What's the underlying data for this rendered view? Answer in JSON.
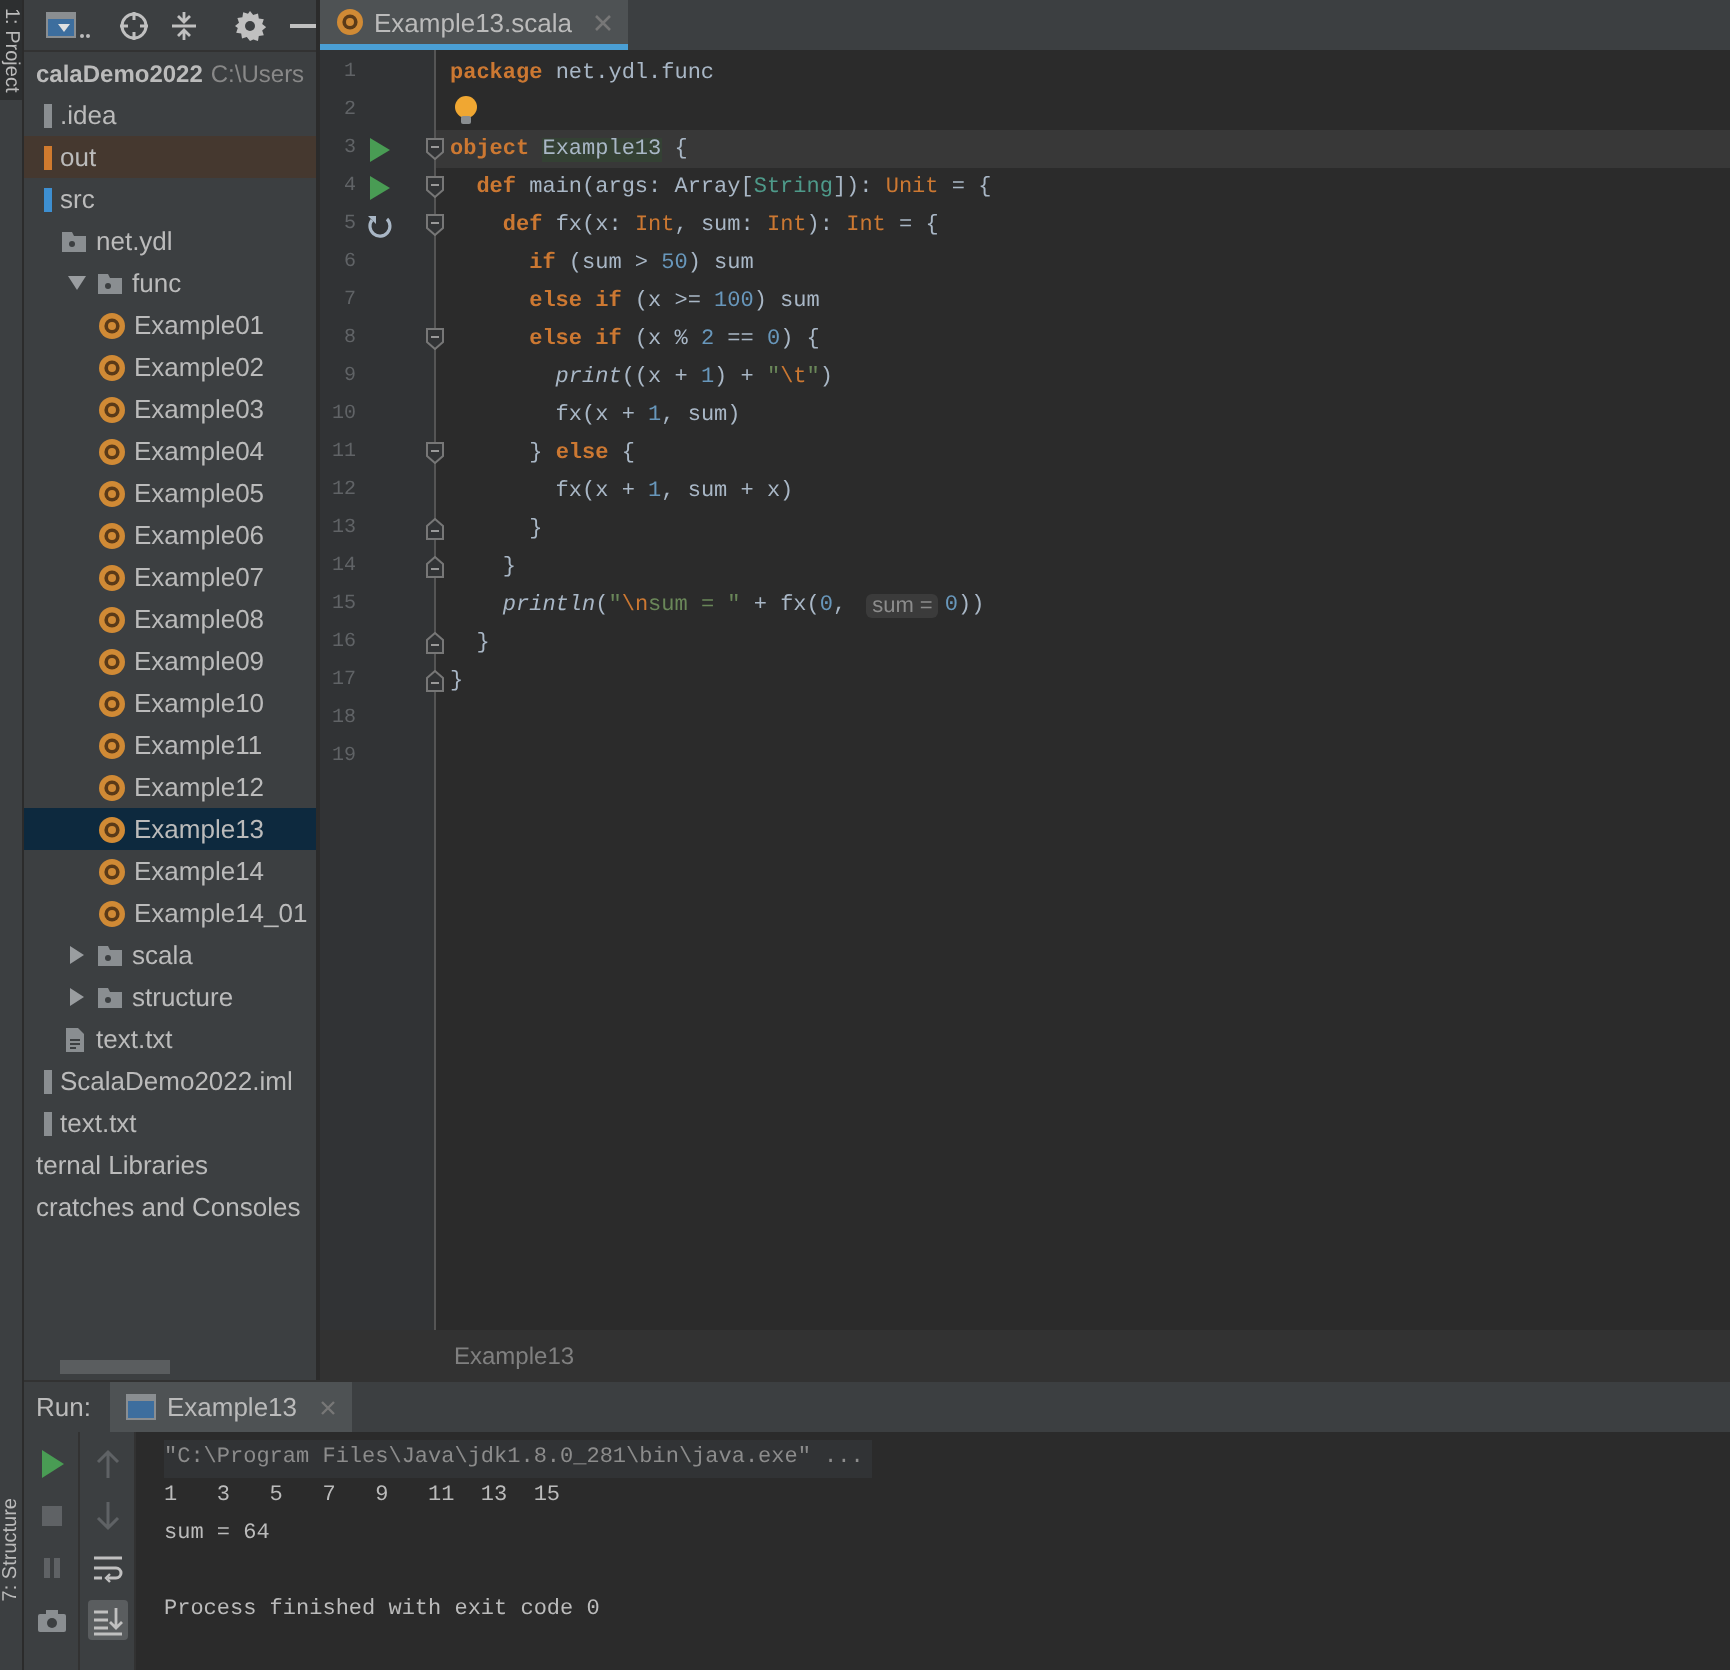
{
  "side_tabs": [
    {
      "label": "1: Project",
      "selected": true
    },
    {
      "label": "7: Structure",
      "selected": false
    }
  ],
  "project_tree": [
    {
      "label": "calaDemo2022",
      "path": "C:\\Users",
      "kind": "project",
      "selected": false,
      "children": [
        {
          "label": ".idea",
          "kind": "folder",
          "selected": false
        },
        {
          "label": "out",
          "kind": "excluded",
          "selected": false
        },
        {
          "label": "src",
          "kind": "source",
          "selected": false,
          "children": [
            {
              "label": "net.ydl",
              "kind": "package",
              "selected": false
            },
            {
              "label": "func",
              "kind": "package",
              "selected": false,
              "expanded": true,
              "children": [
                {
                  "label": "Example01",
                  "kind": "object",
                  "selected": false
                },
                {
                  "label": "Example02",
                  "kind": "object",
                  "selected": false
                },
                {
                  "label": "Example03",
                  "kind": "object",
                  "selected": false
                },
                {
                  "label": "Example04",
                  "kind": "object",
                  "selected": false
                },
                {
                  "label": "Example05",
                  "kind": "object",
                  "selected": false
                },
                {
                  "label": "Example06",
                  "kind": "object",
                  "selected": false
                },
                {
                  "label": "Example07",
                  "kind": "object",
                  "selected": false
                },
                {
                  "label": "Example08",
                  "kind": "object",
                  "selected": false
                },
                {
                  "label": "Example09",
                  "kind": "object",
                  "selected": false
                },
                {
                  "label": "Example10",
                  "kind": "object",
                  "selected": false
                },
                {
                  "label": "Example11",
                  "kind": "object",
                  "selected": false
                },
                {
                  "label": "Example12",
                  "kind": "object",
                  "selected": false
                },
                {
                  "label": "Example13",
                  "kind": "object",
                  "selected": true
                },
                {
                  "label": "Example14",
                  "kind": "object",
                  "selected": false
                },
                {
                  "label": "Example14_01",
                  "kind": "object",
                  "selected": false
                }
              ]
            },
            {
              "label": "scala",
              "kind": "package",
              "selected": false,
              "expanded": false
            },
            {
              "label": "structure",
              "kind": "package",
              "selected": false,
              "expanded": false
            },
            {
              "label": "text.txt",
              "kind": "file",
              "selected": false
            }
          ]
        },
        {
          "label": "ScalaDemo2022.iml",
          "kind": "module",
          "selected": false
        },
        {
          "label": "text.txt",
          "kind": "file",
          "selected": false
        }
      ]
    },
    {
      "label": "ternal Libraries",
      "kind": "libraries",
      "selected": false
    },
    {
      "label": "cratches and Consoles",
      "kind": "scratches",
      "selected": false
    }
  ],
  "editor_tabs": [
    {
      "label": "Example13.scala",
      "selected": true
    }
  ],
  "code_lines": [
    {
      "number": "1",
      "current": false,
      "tokens": [
        {
          "kind": "kw",
          "text": "package"
        },
        {
          "kind": "plain",
          "text": " net.ydl.func"
        }
      ]
    },
    {
      "number": "2",
      "current": false,
      "icons": [
        {
          "kind": "bulb"
        }
      ]
    },
    {
      "number": "3",
      "current": true,
      "icons": [
        {
          "kind": "run"
        },
        {
          "kind": "fold-start"
        }
      ],
      "tokens": [
        {
          "kind": "kw",
          "text": "object "
        },
        {
          "kind": "decl",
          "text": "Example13"
        },
        {
          "kind": "plain",
          "text": " {"
        }
      ]
    },
    {
      "number": "4",
      "current": false,
      "icons": [
        {
          "kind": "run"
        },
        {
          "kind": "fold-start"
        }
      ],
      "tokens": [
        {
          "kind": "kw",
          "text": "  def"
        },
        {
          "kind": "plain",
          "text": " main(args: Array["
        },
        {
          "kind": "type",
          "text": "String"
        },
        {
          "kind": "plain",
          "text": "]): "
        },
        {
          "kind": "kwtype",
          "text": "Unit"
        },
        {
          "kind": "plain",
          "text": " = {"
        }
      ]
    },
    {
      "number": "5",
      "current": false,
      "icons": [
        {
          "kind": "recursion"
        },
        {
          "kind": "fold-start"
        }
      ],
      "tokens": [
        {
          "kind": "kw",
          "text": "    def"
        },
        {
          "kind": "plain",
          "text": " fx(x: "
        },
        {
          "kind": "kwtype",
          "text": "Int"
        },
        {
          "kind": "plain",
          "text": ", sum: "
        },
        {
          "kind": "kwtype",
          "text": "Int"
        },
        {
          "kind": "plain",
          "text": "): "
        },
        {
          "kind": "kwtype",
          "text": "Int"
        },
        {
          "kind": "plain",
          "text": " = {"
        }
      ]
    },
    {
      "number": "6",
      "current": false,
      "tokens": [
        {
          "kind": "kw",
          "text": "      if"
        },
        {
          "kind": "plain",
          "text": " (sum > "
        },
        {
          "kind": "num",
          "text": "50"
        },
        {
          "kind": "plain",
          "text": ") sum"
        }
      ]
    },
    {
      "number": "7",
      "current": false,
      "tokens": [
        {
          "kind": "kw",
          "text": "      else if"
        },
        {
          "kind": "plain",
          "text": " (x >= "
        },
        {
          "kind": "num",
          "text": "100"
        },
        {
          "kind": "plain",
          "text": ") sum"
        }
      ]
    },
    {
      "number": "8",
      "current": false,
      "icons": [
        {
          "kind": "fold-start"
        }
      ],
      "tokens": [
        {
          "kind": "kw",
          "text": "      else if"
        },
        {
          "kind": "plain",
          "text": " (x % "
        },
        {
          "kind": "num",
          "text": "2"
        },
        {
          "kind": "plain",
          "text": " == "
        },
        {
          "kind": "num",
          "text": "0"
        },
        {
          "kind": "plain",
          "text": ") {"
        }
      ]
    },
    {
      "number": "9",
      "current": false,
      "tokens": [
        {
          "kind": "call",
          "text": "        print"
        },
        {
          "kind": "plain",
          "text": "((x + "
        },
        {
          "kind": "num",
          "text": "1"
        },
        {
          "kind": "plain",
          "text": ") + "
        },
        {
          "kind": "str",
          "text": "\""
        },
        {
          "kind": "esc",
          "text": "\\t"
        },
        {
          "kind": "str",
          "text": "\""
        },
        {
          "kind": "plain",
          "text": ")"
        }
      ]
    },
    {
      "number": "10",
      "current": false,
      "tokens": [
        {
          "kind": "plain",
          "text": "        fx(x + "
        },
        {
          "kind": "num",
          "text": "1"
        },
        {
          "kind": "plain",
          "text": ", sum)"
        }
      ]
    },
    {
      "number": "11",
      "current": false,
      "icons": [
        {
          "kind": "fold-start"
        }
      ],
      "tokens": [
        {
          "kind": "plain",
          "text": "      } "
        },
        {
          "kind": "kw",
          "text": "else"
        },
        {
          "kind": "plain",
          "text": " {"
        }
      ]
    },
    {
      "number": "12",
      "current": false,
      "tokens": [
        {
          "kind": "plain",
          "text": "        fx(x + "
        },
        {
          "kind": "num",
          "text": "1"
        },
        {
          "kind": "plain",
          "text": ", sum + x)"
        }
      ]
    },
    {
      "number": "13",
      "current": false,
      "icons": [
        {
          "kind": "fold-end"
        }
      ],
      "tokens": [
        {
          "kind": "plain",
          "text": "      }"
        }
      ]
    },
    {
      "number": "14",
      "current": false,
      "icons": [
        {
          "kind": "fold-end"
        }
      ],
      "tokens": [
        {
          "kind": "plain",
          "text": "    }"
        }
      ]
    },
    {
      "number": "15",
      "current": false,
      "tokens": [
        {
          "kind": "call",
          "text": "    println"
        },
        {
          "kind": "plain",
          "text": "("
        },
        {
          "kind": "str",
          "text": "\""
        },
        {
          "kind": "esc",
          "text": "\\n"
        },
        {
          "kind": "str",
          "text": "sum = \""
        },
        {
          "kind": "plain",
          "text": " + fx("
        },
        {
          "kind": "num",
          "text": "0"
        },
        {
          "kind": "plain",
          "text": ","
        },
        {
          "kind": "hint",
          "text": "sum ="
        },
        {
          "kind": "num",
          "text": "0"
        },
        {
          "kind": "plain",
          "text": "))"
        }
      ]
    },
    {
      "number": "16",
      "current": false,
      "icons": [
        {
          "kind": "fold-end"
        }
      ],
      "tokens": [
        {
          "kind": "plain",
          "text": "  }"
        }
      ]
    },
    {
      "number": "17",
      "current": false,
      "icons": [
        {
          "kind": "fold-end"
        }
      ],
      "tokens": [
        {
          "kind": "plain",
          "text": "}"
        }
      ]
    },
    {
      "number": "18",
      "current": false
    },
    {
      "number": "19",
      "current": false
    }
  ],
  "breadcrumb": "Example13",
  "run_panel": {
    "label": "Run:",
    "tabs": [
      {
        "label": "Example13",
        "selected": true
      }
    ],
    "toolbar_left": [
      {
        "kind": "run",
        "disabled": false
      },
      {
        "kind": "stop",
        "disabled": true
      },
      {
        "kind": "pause",
        "disabled": true
      },
      {
        "kind": "camera",
        "disabled": false
      }
    ],
    "toolbar_right": [
      {
        "kind": "up",
        "disabled": true,
        "on": false
      },
      {
        "kind": "down",
        "disabled": true,
        "on": false
      },
      {
        "kind": "wrap",
        "disabled": false,
        "on": false
      },
      {
        "kind": "scroll",
        "disabled": false,
        "on": true
      }
    ],
    "console": [
      {
        "kind": "command",
        "text": "\"C:\\Program Files\\Java\\jdk1.8.0_281\\bin\\java.exe\" ..."
      },
      {
        "kind": "output",
        "text": "1   3   5   7   9   11  13  15"
      },
      {
        "kind": "output",
        "text": "sum = 64"
      },
      {
        "kind": "system",
        "text": "Process finished with exit code 0"
      }
    ]
  }
}
